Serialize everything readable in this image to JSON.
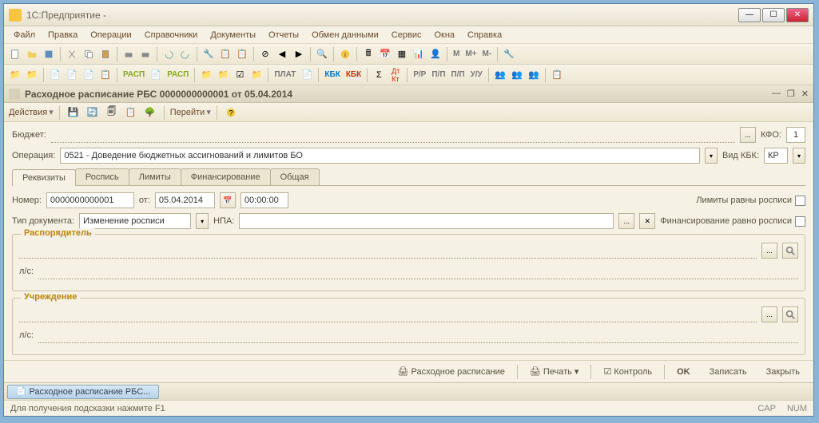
{
  "window": {
    "title": "1С:Предприятие -"
  },
  "menu": [
    "Файл",
    "Правка",
    "Операции",
    "Справочники",
    "Документы",
    "Отчеты",
    "Обмен данными",
    "Сервис",
    "Окна",
    "Справка"
  ],
  "doc": {
    "title": "Расходное расписание РБС 0000000000001 от 05.04.2014"
  },
  "actionbar": {
    "actions": "Действия",
    "goto": "Перейти"
  },
  "form": {
    "budget_label": "Бюджет:",
    "kfo_label": "КФО:",
    "kfo_value": "1",
    "operation_label": "Операция:",
    "operation_value": "0521 - Доведение бюджетных ассигнований и лимитов БО",
    "vidkbk_label": "Вид КБК:",
    "vidkbk_value": "КР"
  },
  "tabs": [
    "Реквизиты",
    "Роспись",
    "Лимиты",
    "Финансирование",
    "Общая"
  ],
  "reqs": {
    "number_label": "Номер:",
    "number_value": "0000000000001",
    "ot_label": "от:",
    "date_value": "05.04.2014",
    "time_value": "00:00:00",
    "limits_equal": "Лимиты равны росписи",
    "doctype_label": "Тип документа:",
    "doctype_value": "Изменение росписи",
    "npa_label": "НПА:",
    "fin_equal": "Финансирование равно росписи",
    "rasporyad": "Распорядитель",
    "uchrezhd": "Учреждение",
    "ls_label": "л/с:"
  },
  "bottom": {
    "rashod": "Расходное расписание",
    "print": "Печать",
    "control": "Контроль",
    "ok": "OK",
    "save": "Записать",
    "close": "Закрыть"
  },
  "task": "Расходное расписание РБС...",
  "status": {
    "hint": "Для получения подсказки нажмите F1",
    "cap": "CAP",
    "num": "NUM"
  }
}
